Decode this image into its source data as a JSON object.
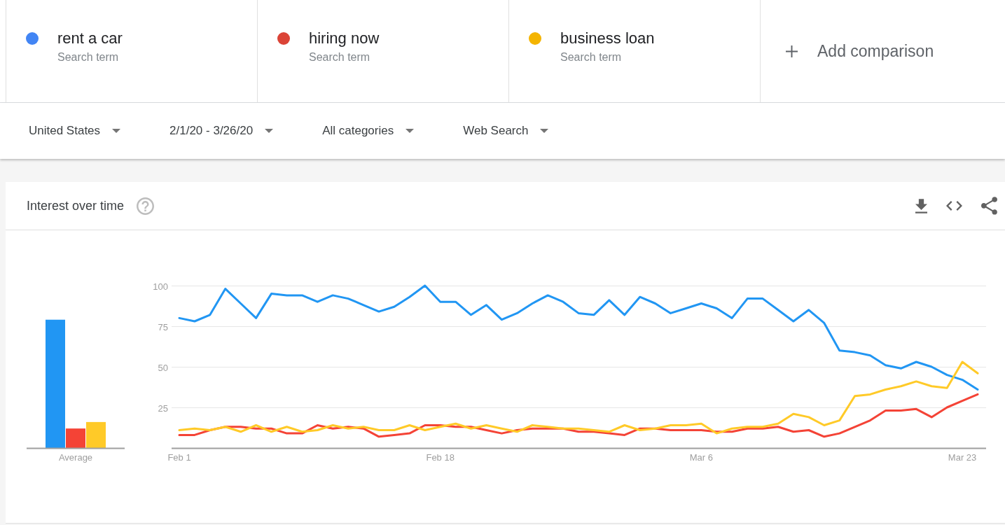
{
  "comparison_bar": {
    "terms": [
      {
        "term": "rent a car",
        "subtitle": "Search term",
        "color": "#4285f4"
      },
      {
        "term": "hiring now",
        "subtitle": "Search term",
        "color": "#db4437"
      },
      {
        "term": "business loan",
        "subtitle": "Search term",
        "color": "#f4b400"
      }
    ],
    "add_button": {
      "label": "Add comparison"
    }
  },
  "filters": [
    {
      "label": "United States"
    },
    {
      "label": "2/1/20 - 3/26/20"
    },
    {
      "label": "All categories"
    },
    {
      "label": "Web Search"
    }
  ],
  "interest_over_time": {
    "title": "Interest over time",
    "average_chart": {
      "chart_data": {
        "type": "bar",
        "categories": [
          "Average"
        ],
        "ylim": [
          0,
          100
        ],
        "series": [
          {
            "color": "#2196f3",
            "values": [
              79
            ]
          },
          {
            "color": "#f44336",
            "values": [
              12
            ]
          },
          {
            "color": "#ffca28",
            "values": [
              16
            ]
          }
        ]
      }
    },
    "trend_chart": {
      "chart_data": {
        "type": "line",
        "categories": [
          "Feb 1",
          null,
          null,
          null,
          null,
          null,
          null,
          null,
          null,
          null,
          null,
          null,
          null,
          null,
          null,
          null,
          null,
          "Feb 18",
          null,
          null,
          null,
          null,
          null,
          null,
          null,
          null,
          null,
          null,
          null,
          null,
          null,
          null,
          null,
          null,
          "Mar 6",
          null,
          null,
          null,
          null,
          null,
          null,
          null,
          null,
          null,
          null,
          null,
          null,
          null,
          null,
          null,
          null,
          "Mar 23",
          null
        ],
        "ylim": [
          0,
          100
        ],
        "yticks": [
          25,
          50,
          75,
          100
        ],
        "grid": true,
        "series": [
          {
            "color": "#2196f3",
            "values": [
              80,
              78,
              82,
              98,
              89,
              80,
              95,
              94,
              94,
              90,
              94,
              92,
              88,
              84,
              87,
              93,
              100,
              90,
              90,
              82,
              88,
              79,
              83,
              89,
              94,
              90,
              83,
              82,
              91,
              82,
              93,
              89,
              83,
              86,
              89,
              86,
              80,
              92,
              92,
              85,
              78,
              85,
              77,
              60,
              59,
              57,
              51,
              49,
              53,
              50,
              45,
              42,
              36
            ]
          },
          {
            "color": "#f44336",
            "values": [
              8,
              8,
              11,
              13,
              13,
              12,
              12,
              9,
              9,
              14,
              12,
              13,
              12,
              7,
              8,
              9,
              14,
              14,
              13,
              13,
              11,
              9,
              11,
              12,
              12,
              12,
              10,
              10,
              9,
              8,
              12,
              12,
              11,
              11,
              11,
              10,
              10,
              12,
              12,
              13,
              10,
              11,
              7,
              9,
              13,
              17,
              23,
              23,
              24,
              19,
              25,
              29,
              33
            ]
          },
          {
            "color": "#ffca28",
            "values": [
              11,
              12,
              11,
              13,
              10,
              14,
              10,
              13,
              10,
              11,
              14,
              12,
              13,
              11,
              11,
              14,
              11,
              13,
              15,
              12,
              14,
              12,
              10,
              14,
              13,
              12,
              12,
              11,
              10,
              14,
              11,
              12,
              14,
              14,
              15,
              9,
              12,
              13,
              13,
              15,
              21,
              19,
              14,
              17,
              32,
              33,
              36,
              38,
              41,
              38,
              37,
              53,
              46
            ]
          }
        ]
      }
    }
  }
}
